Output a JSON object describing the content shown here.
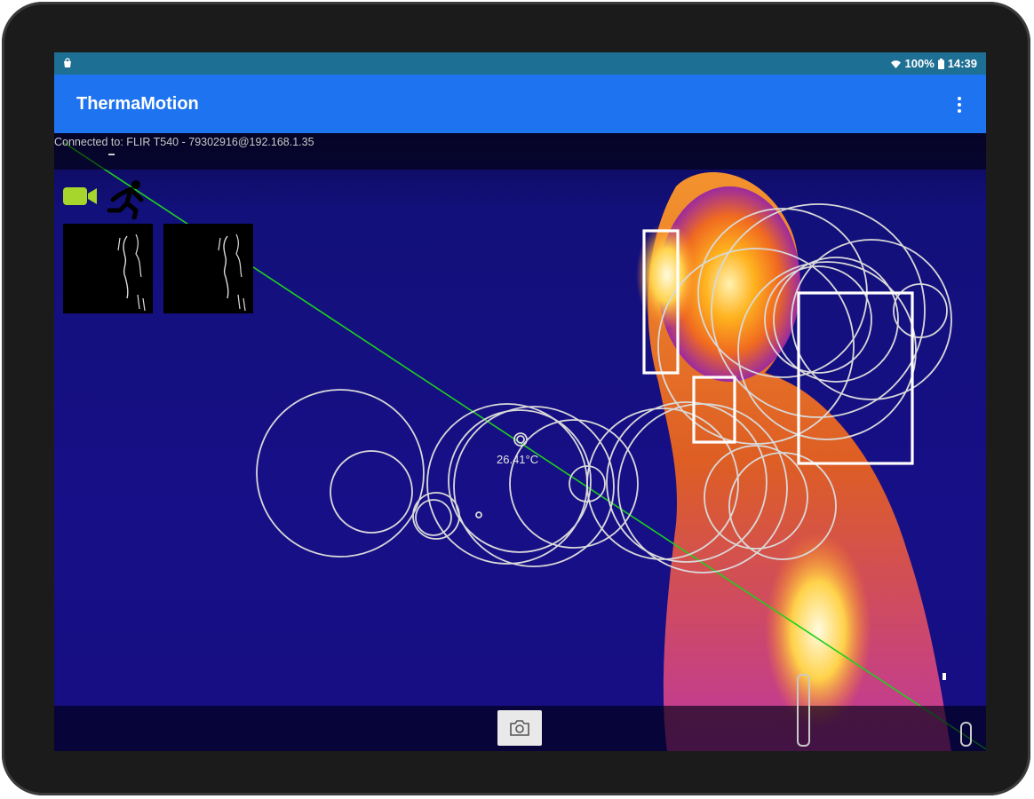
{
  "status_bar": {
    "notification_icon": "shopping-bag-icon",
    "signal_icon": "wifi-icon",
    "battery_text": "100%",
    "battery_icon": "battery-icon",
    "time": "14:39"
  },
  "app_bar": {
    "title": "ThermaMotion",
    "menu_icon": "more-vert-icon"
  },
  "connection": {
    "text": "Connected to: FLIR T540 - 79302916@192.168.1.35"
  },
  "overlay": {
    "recording_icon": "video-camera-icon",
    "motion_icon": "running-person-icon",
    "thumbnails": [
      "motion-thumbnail-1",
      "motion-thumbnail-2"
    ],
    "spot_temperature": "26.41°C"
  },
  "bottom_bar": {
    "snapshot_icon": "camera-icon"
  },
  "colors": {
    "status_bar": "#1d6f93",
    "app_bar": "#1e73f0",
    "thermal_background": "#160e80",
    "tracking_line": "#1fd01f",
    "overlay_stroke": "#d9d9d9"
  }
}
